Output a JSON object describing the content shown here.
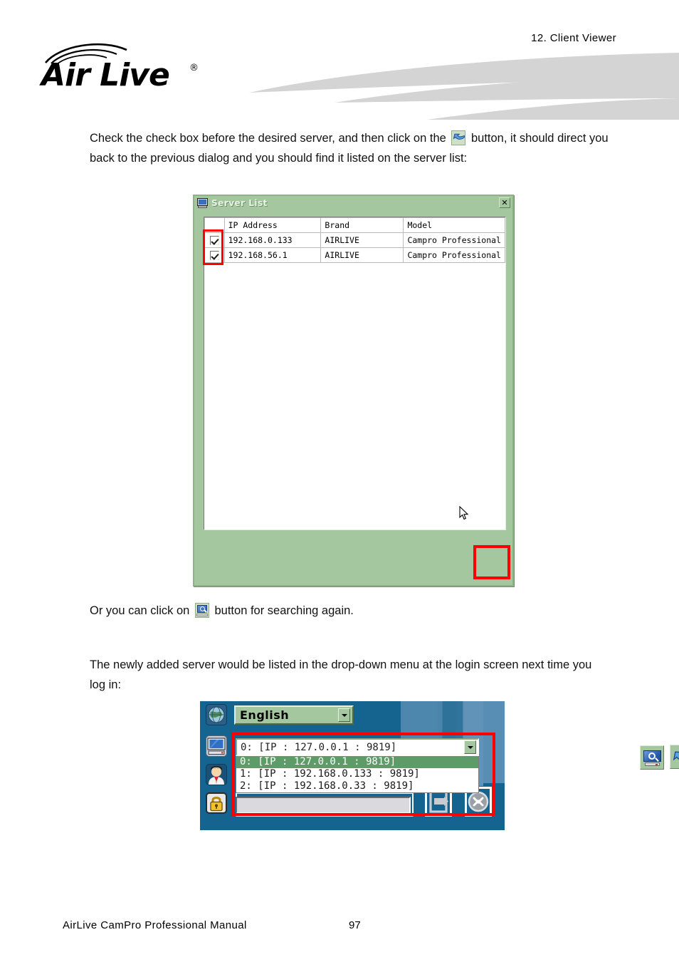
{
  "header": {
    "chapter": "12.  Client  Viewer",
    "logo_text": "Air Live",
    "logo_reg": "®",
    "logo_icon": "wireless-arcs-icon"
  },
  "paragraphs": {
    "p1_before": "Check the check box before the desired server, and then click on the",
    "p1_icon": "back-arrow-icon",
    "p1_after": "button, it should direct you back to the previous dialog and you should find it listed on the server list:",
    "p2_before": "Or you can click on",
    "p2_icon": "monitor-search-icon",
    "p2_after": "button for searching again.",
    "p3": "The newly added server would be listed in the drop-down menu at the login screen next time you log in:"
  },
  "server_list_dialog": {
    "title": "Server List",
    "title_icon": "monitor-icon",
    "close_label": "✕",
    "columns": [
      "",
      "IP Address",
      "Brand",
      "Model"
    ],
    "rows": [
      {
        "checked": true,
        "ip": "192.168.0.133",
        "brand": "AIRLIVE",
        "model": "Campro Professional"
      },
      {
        "checked": true,
        "ip": "192.168.56.1",
        "brand": "AIRLIVE",
        "model": "Campro Professional"
      }
    ],
    "buttons": [
      {
        "name": "search-again-button",
        "icon": "monitor-search-icon"
      },
      {
        "name": "back-button",
        "icon": "back-arrow-icon"
      }
    ],
    "highlight_color": "#ff0000",
    "body_color": "#a5c79f"
  },
  "login_screen": {
    "icons": [
      "globe-icon",
      "monitor-icon",
      "user-icon",
      "lock-icon"
    ],
    "language": {
      "label": "English",
      "arrow_icon": "chevron-down-icon"
    },
    "server_combo": {
      "value": "0: [IP : 127.0.0.1 : 9819]",
      "arrow_icon": "chevron-down-icon",
      "options": [
        "0: [IP : 127.0.0.1 : 9819]",
        "1: [IP : 192.168.0.133 : 9819]",
        "2: [IP : 192.168.0.33 : 9819]"
      ],
      "selected_index": 0
    },
    "text_field_value": "",
    "buttons": [
      {
        "name": "login-button",
        "icon": "enter-door-icon"
      },
      {
        "name": "exit-button",
        "icon": "close-circle-icon"
      }
    ],
    "background_color": "#15648f",
    "highlight_color": "#ff0000"
  },
  "footer": {
    "title": "AirLive  CamPro  Professional  Manual",
    "page": "97"
  }
}
